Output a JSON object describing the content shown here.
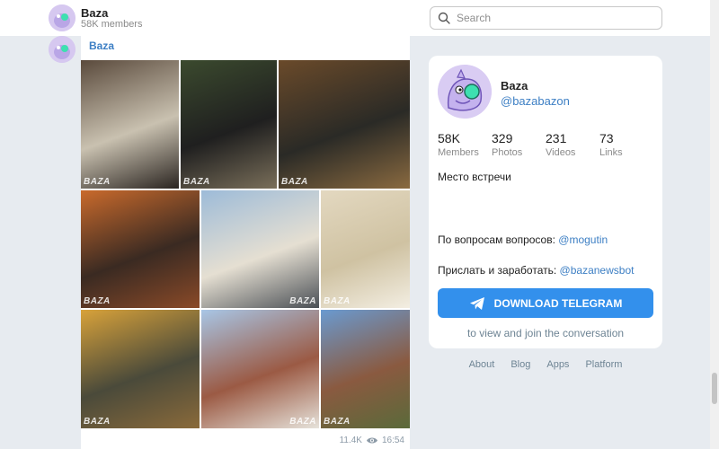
{
  "header": {
    "title": "Baza",
    "subtitle": "58K members",
    "search_placeholder": "Search"
  },
  "post": {
    "author": "Baza",
    "watermark": "BAZA",
    "views": "11.4K",
    "time": "16:54",
    "photos": [
      {
        "name": "photo-interior-window",
        "colors": [
          "#5a4a3c",
          "#c9c1b0",
          "#2a2420"
        ]
      },
      {
        "name": "photo-snowmobile",
        "colors": [
          "#3b4a2e",
          "#1f1f1f",
          "#7a6f5a"
        ]
      },
      {
        "name": "photo-atv-garden",
        "colors": [
          "#6a4a2a",
          "#2a2a26",
          "#8a6a40"
        ]
      },
      {
        "name": "photo-orange-utv",
        "colors": [
          "#c96a2c",
          "#3a2a22",
          "#8a4a28"
        ]
      },
      {
        "name": "photo-house-garage",
        "colors": [
          "#9dbbd8",
          "#e5dfd2",
          "#4a4f55"
        ]
      },
      {
        "name": "photo-bathtub",
        "colors": [
          "#e3d8c0",
          "#cfc2a2",
          "#f3eee2"
        ]
      },
      {
        "name": "photo-yellow-buggy",
        "colors": [
          "#d8a23a",
          "#4a4a3a",
          "#8a6a3a"
        ]
      },
      {
        "name": "photo-brick-house",
        "colors": [
          "#a8c6e6",
          "#9b5a44",
          "#e6e2da"
        ]
      },
      {
        "name": "photo-house-trees",
        "colors": [
          "#6a9ad0",
          "#8a5a40",
          "#5a6a3a"
        ]
      }
    ]
  },
  "card": {
    "title": "Baza",
    "handle": "@bazabazon",
    "stats": [
      {
        "n": "58K",
        "l": "Members"
      },
      {
        "n": "329",
        "l": "Photos"
      },
      {
        "n": "231",
        "l": "Videos"
      },
      {
        "n": "73",
        "l": "Links"
      }
    ],
    "description": "Место встречи",
    "contact_prefix": "По вопросам вопросов:",
    "contact_link": "@mogutin",
    "send_prefix": "Прислать и заработать:",
    "send_link": "@bazanewsbot",
    "download_label": "DOWNLOAD TELEGRAM",
    "join_note": "to view and join the conversation"
  },
  "footer": {
    "links": [
      "About",
      "Blog",
      "Apps",
      "Platform"
    ]
  },
  "colors": {
    "accent": "#3390ec",
    "link": "#3d7fc4",
    "background": "#e7ebf0"
  }
}
